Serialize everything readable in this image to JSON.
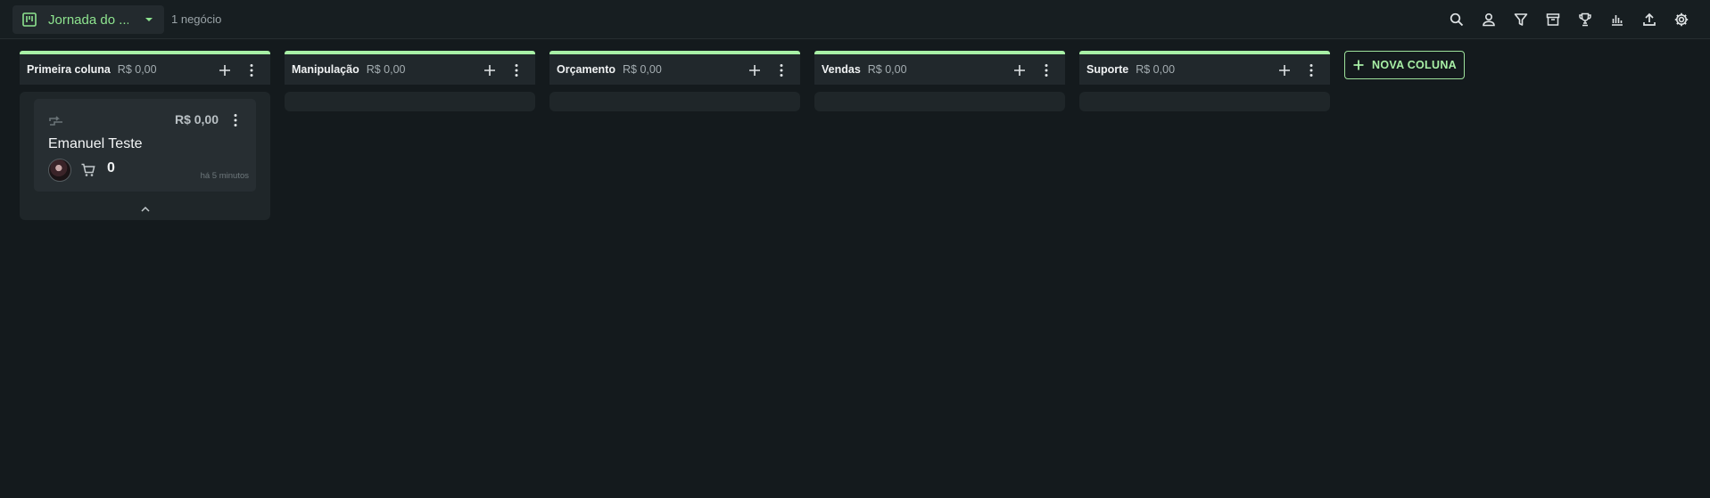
{
  "topbar": {
    "board_name": "Jornada do ...",
    "deal_count": "1 negócio",
    "tools": [
      "search-icon",
      "person-icon",
      "filter-icon",
      "archive-icon",
      "trophy-icon",
      "bar-chart-icon",
      "upload-icon",
      "gear-icon"
    ]
  },
  "colors": {
    "accent": "#a8f0a6",
    "background": "#141a1d"
  },
  "columns": [
    {
      "title": "Primeira coluna",
      "total": "R$ 0,00"
    },
    {
      "title": "Manipulação",
      "total": "R$ 0,00"
    },
    {
      "title": "Orçamento",
      "total": "R$ 0,00"
    },
    {
      "title": "Vendas",
      "total": "R$ 0,00"
    },
    {
      "title": "Suporte",
      "total": "R$ 0,00"
    }
  ],
  "card": {
    "value": "R$ 0,00",
    "name": "Emanuel Teste",
    "cart_count": "0",
    "time": "há 5 minutos"
  },
  "new_column_label": "NOVA COLUNA"
}
